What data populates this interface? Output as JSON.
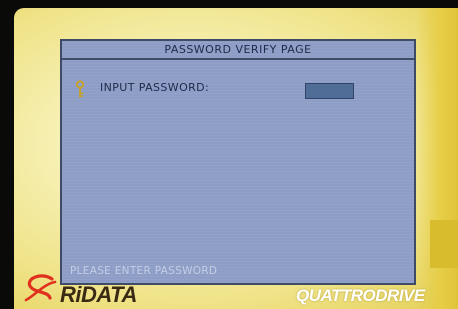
{
  "dialog": {
    "title": "PASSWORD VERIFY PAGE",
    "field_label": "INPUT PASSWORD:",
    "password_value": "",
    "hint": "PLEASE ENTER PASSWORD"
  },
  "branding": {
    "left_logo_text": "RiDATA",
    "right_logo_text": "QUATTRODRIVE"
  },
  "icons": {
    "field_icon": "key-icon",
    "brand_icon": "ridata-swoosh-icon"
  },
  "colors": {
    "screen_background": "#f1e79a",
    "dialog_background": "#8d9dc6",
    "dialog_border": "#3e4a66",
    "text": "#1e2a4a",
    "hint_text": "#c4cde6",
    "field_fill": "#4f6d96",
    "brand_red": "#e0301e"
  }
}
